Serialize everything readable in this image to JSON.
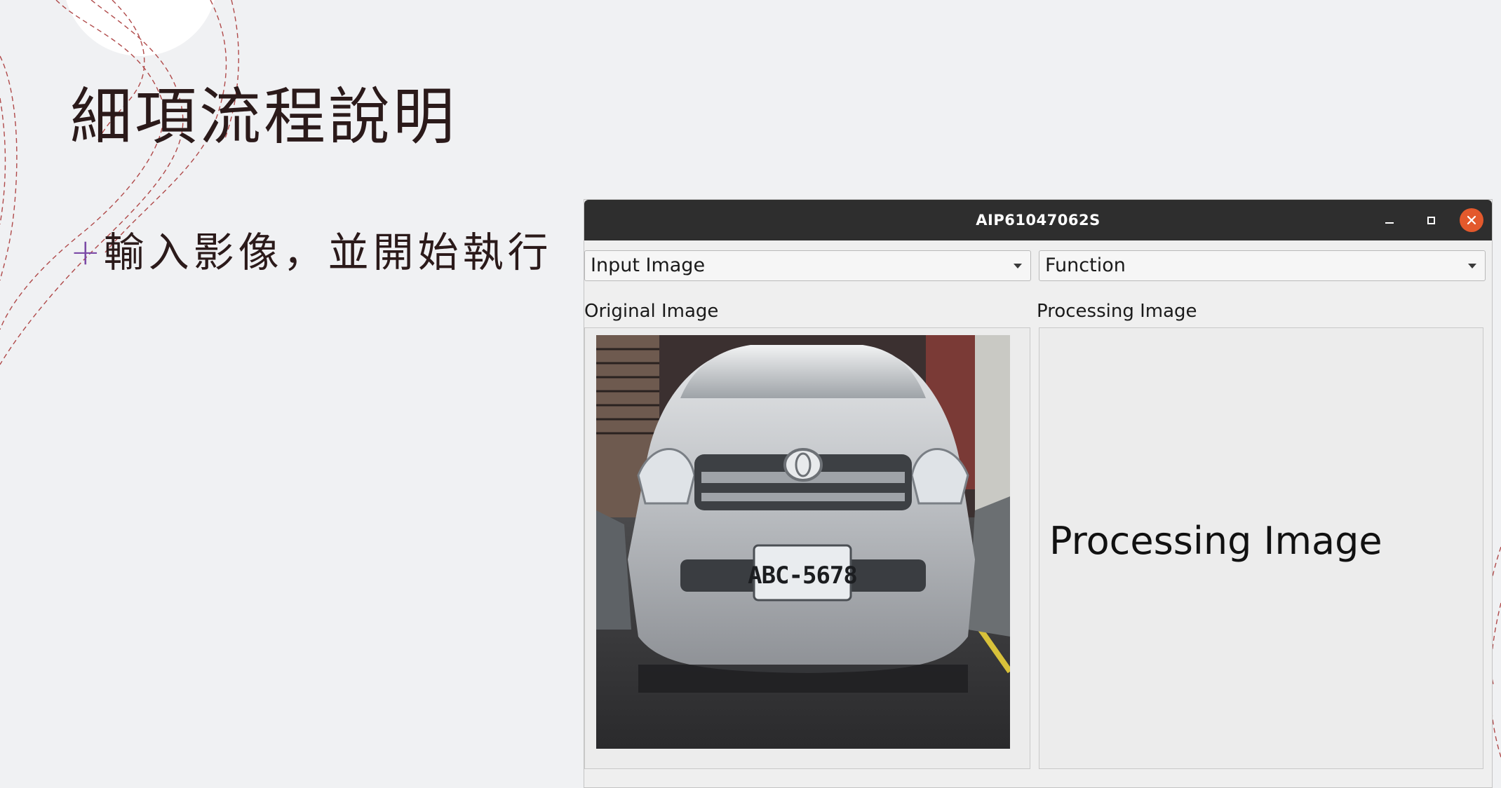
{
  "slide": {
    "title": "細項流程說明",
    "bullet_symbol": "+",
    "bullet_text": "輸入影像，並開始執行"
  },
  "window": {
    "title": "AIP61047062S",
    "controls": {
      "minimize_icon": "minimize-icon",
      "maximize_icon": "maximize-icon",
      "close_icon": "close-icon"
    },
    "input_combo": {
      "selected": "Input Image"
    },
    "function_combo": {
      "selected": "Function"
    },
    "original_label": "Original Image",
    "processing_label": "Processing Image",
    "processing_placeholder": "Processing Image",
    "photo": {
      "subject": "silver Toyota minivan front view",
      "plate_text": "ABC-5678"
    }
  },
  "colors": {
    "background": "#f0f1f3",
    "titlebar": "#2e2e2e",
    "close_button": "#e3592c",
    "bullet_accent": "#7b4aa6",
    "deco_line": "#b04a4a"
  }
}
